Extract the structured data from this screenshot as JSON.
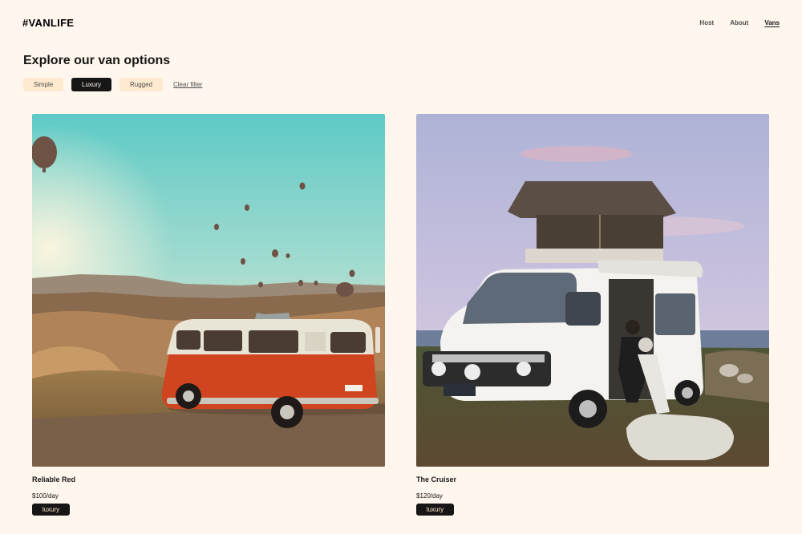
{
  "brand": {
    "logo": "#VANLIFE"
  },
  "nav": {
    "host": "Host",
    "about": "About",
    "vans": "Vans",
    "active": "Vans"
  },
  "page": {
    "title": "Explore our van options"
  },
  "filters": {
    "options": [
      {
        "label": "Simple",
        "active": false
      },
      {
        "label": "Luxury",
        "active": true
      },
      {
        "label": "Rugged",
        "active": false
      }
    ],
    "clear_label": "Clear filter"
  },
  "vans": [
    {
      "name": "Reliable Red",
      "price": "$100/day",
      "type": "luxury",
      "image": "orange VW bus on a cliff with hot air balloons at sunset"
    },
    {
      "name": "The Cruiser",
      "price": "$120/day",
      "type": "luxury",
      "image": "white campervan with rooftop tent and people sitting in side door by the sea"
    }
  ],
  "colors": {
    "background": "#FFF7ED",
    "chip": "#FFEAD0",
    "dark": "#161616",
    "muted": "#4D4D4D"
  }
}
